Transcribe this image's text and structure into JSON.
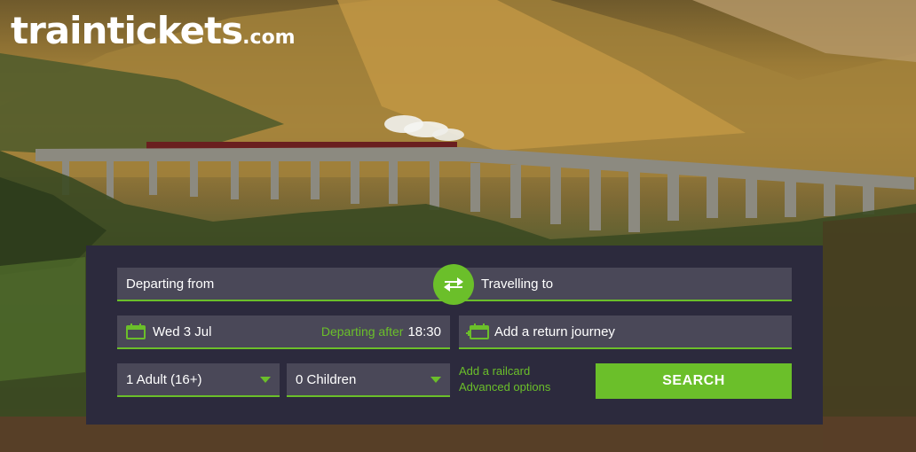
{
  "logo": {
    "main": "traintickets",
    "tld": ".com"
  },
  "search_form": {
    "departing_from_placeholder": "Departing from",
    "travelling_to_placeholder": "Travelling to",
    "swap_icon": "swap-arrows-icon",
    "date": "Wed 3 Jul",
    "departing_after_label": "Departing after",
    "departing_time": "18:30",
    "return_label": "Add a return journey",
    "adults": "1 Adult (16+)",
    "children": "0 Children",
    "add_railcard": "Add a railcard",
    "advanced_options": "Advanced options",
    "search_label": "SEARCH"
  },
  "colors": {
    "accent": "#6bbf2a",
    "panel": "#2c2a3d",
    "field": "#4a4858"
  }
}
